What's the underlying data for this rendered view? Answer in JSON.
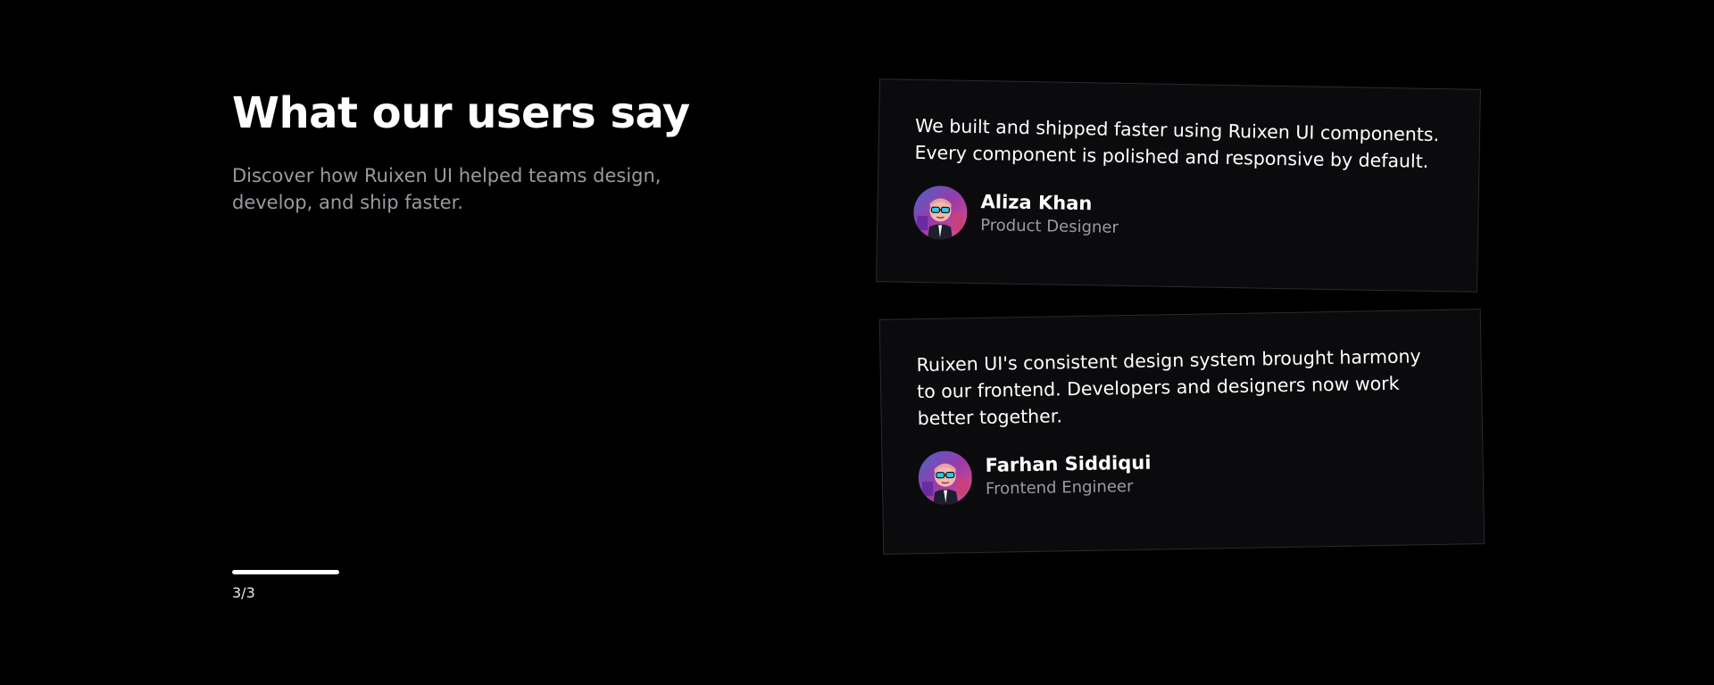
{
  "section": {
    "title": "What our users say",
    "subtitle": "Discover how Ruixen UI helped teams design, develop, and ship faster."
  },
  "pagination": {
    "label": "3/3",
    "progress": 1.0
  },
  "testimonials": [
    {
      "quote": "We built and shipped faster using Ruixen UI components. Every component is polished and responsive by default.",
      "name": "Aliza Khan",
      "role": "Product Designer",
      "avatar_icon": "cartoon-avatar-icon"
    },
    {
      "quote": "Ruixen UI's consistent design system brought harmony to our frontend. Developers and designers now work better together.",
      "name": "Farhan Siddiqui",
      "role": "Frontend Engineer",
      "avatar_icon": "cartoon-avatar-icon"
    }
  ],
  "colors": {
    "background": "#000000",
    "card_background": "#0b0b0d",
    "card_border": "#2a2a2e",
    "muted_text": "#9a9aa2",
    "primary_text": "#ffffff",
    "progress_fill": "#ffffff"
  }
}
